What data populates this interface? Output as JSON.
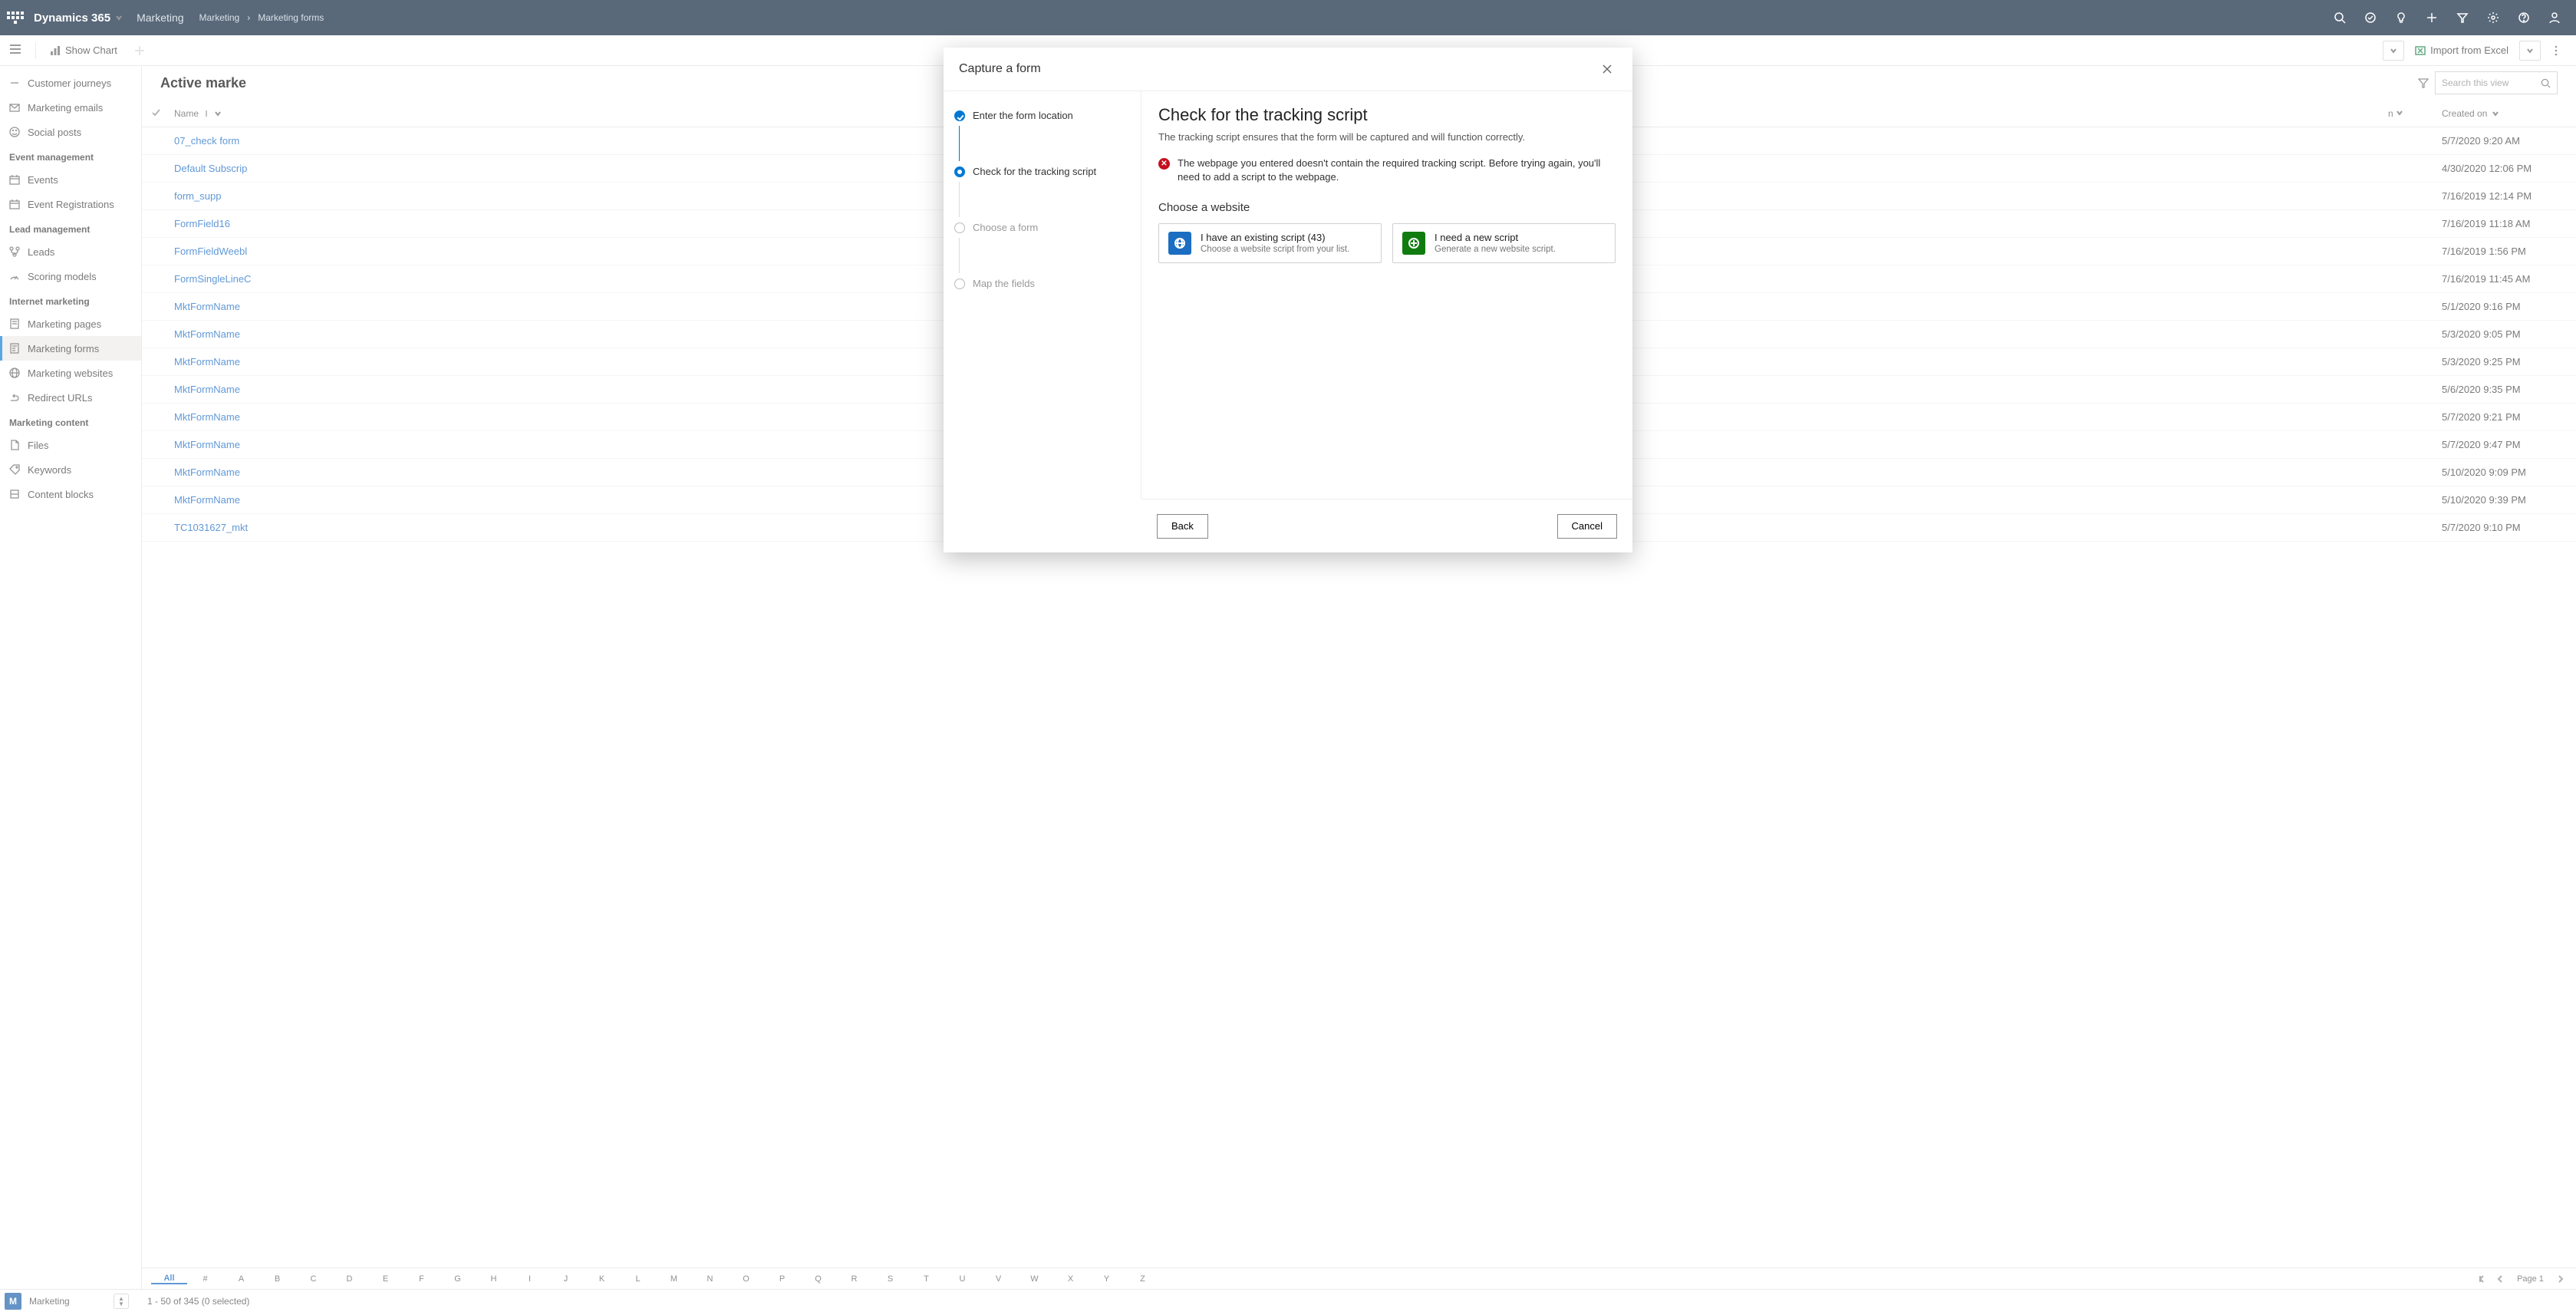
{
  "topbar": {
    "brand": "Dynamics 365",
    "area": "Marketing",
    "breadcrumb": [
      "Marketing",
      "Marketing forms"
    ]
  },
  "commands": {
    "show_chart": "Show Chart",
    "import_excel": "Import from Excel"
  },
  "sidebar": {
    "groups": [
      {
        "label": "",
        "items": [
          {
            "name": "customer-journeys",
            "label": "Customer journeys",
            "icon": "arrow-right"
          },
          {
            "name": "marketing-emails",
            "label": "Marketing emails",
            "icon": "mail"
          },
          {
            "name": "social-posts",
            "label": "Social posts",
            "icon": "smile"
          }
        ]
      },
      {
        "label": "Event management",
        "items": [
          {
            "name": "events",
            "label": "Events",
            "icon": "calendar"
          },
          {
            "name": "event-registrations",
            "label": "Event Registrations",
            "icon": "calendar"
          }
        ]
      },
      {
        "label": "Lead management",
        "items": [
          {
            "name": "leads",
            "label": "Leads",
            "icon": "branch"
          },
          {
            "name": "scoring-models",
            "label": "Scoring models",
            "icon": "gauge"
          }
        ]
      },
      {
        "label": "Internet marketing",
        "items": [
          {
            "name": "marketing-pages",
            "label": "Marketing pages",
            "icon": "page"
          },
          {
            "name": "marketing-forms",
            "label": "Marketing forms",
            "icon": "form",
            "active": true
          },
          {
            "name": "marketing-websites",
            "label": "Marketing websites",
            "icon": "globe"
          },
          {
            "name": "redirect-urls",
            "label": "Redirect URLs",
            "icon": "redirect"
          }
        ]
      },
      {
        "label": "Marketing content",
        "items": [
          {
            "name": "files",
            "label": "Files",
            "icon": "file"
          },
          {
            "name": "keywords",
            "label": "Keywords",
            "icon": "tag"
          },
          {
            "name": "content-blocks",
            "label": "Content blocks",
            "icon": "block"
          }
        ]
      }
    ]
  },
  "view": {
    "title": "Active marke",
    "search_placeholder": "Search this view",
    "columns": {
      "name": "Name",
      "created": "Created on"
    },
    "rows": [
      {
        "name": "07_check form",
        "created": "5/7/2020 9:20 AM"
      },
      {
        "name": "Default Subscrip",
        "created": "4/30/2020 12:06 PM"
      },
      {
        "name": "form_supp",
        "created": "7/16/2019 12:14 PM"
      },
      {
        "name": "FormField16",
        "created": "7/16/2019 11:18 AM"
      },
      {
        "name": "FormFieldWeebl",
        "created": "7/16/2019 1:56 PM"
      },
      {
        "name": "FormSingleLineC",
        "created": "7/16/2019 11:45 AM"
      },
      {
        "name": "MktFormName",
        "created": "5/1/2020 9:16 PM"
      },
      {
        "name": "MktFormName",
        "created": "5/3/2020 9:05 PM"
      },
      {
        "name": "MktFormName",
        "created": "5/3/2020 9:25 PM"
      },
      {
        "name": "MktFormName",
        "created": "5/6/2020 9:35 PM"
      },
      {
        "name": "MktFormName",
        "created": "5/7/2020 9:21 PM"
      },
      {
        "name": "MktFormName",
        "created": "5/7/2020 9:47 PM"
      },
      {
        "name": "MktFormName",
        "created": "5/10/2020 9:09 PM"
      },
      {
        "name": "MktFormName",
        "created": "5/10/2020 9:39 PM"
      },
      {
        "name": "TC1031627_mkt",
        "created": "5/7/2020 9:10 PM"
      }
    ]
  },
  "alpha": [
    "All",
    "#",
    "A",
    "B",
    "C",
    "D",
    "E",
    "F",
    "G",
    "H",
    "I",
    "J",
    "K",
    "L",
    "M",
    "N",
    "O",
    "P",
    "Q",
    "R",
    "S",
    "T",
    "U",
    "V",
    "W",
    "X",
    "Y",
    "Z"
  ],
  "pager": {
    "label": "Page 1"
  },
  "status": {
    "area_letter": "M",
    "area_name": "Marketing",
    "count": "1 - 50 of 345 (0 selected)"
  },
  "modal": {
    "title": "Capture a form",
    "steps": [
      {
        "label": "Enter the form location",
        "state": "done"
      },
      {
        "label": "Check for the tracking script",
        "state": "active"
      },
      {
        "label": "Choose a form",
        "state": "pending"
      },
      {
        "label": "Map the fields",
        "state": "pending"
      }
    ],
    "panel": {
      "heading": "Check for the tracking script",
      "sub": "The tracking script ensures that the form will be captured and will function correctly.",
      "error": "The webpage you entered doesn't contain the required tracking script. Before trying again, you'll need to add a script to the webpage.",
      "choose_label": "Choose a website",
      "card1_title": "I have an existing script (43)",
      "card1_sub": "Choose a website script from your list.",
      "card2_title": "I need a new script",
      "card2_sub": "Generate a new website script."
    },
    "back": "Back",
    "cancel": "Cancel"
  }
}
